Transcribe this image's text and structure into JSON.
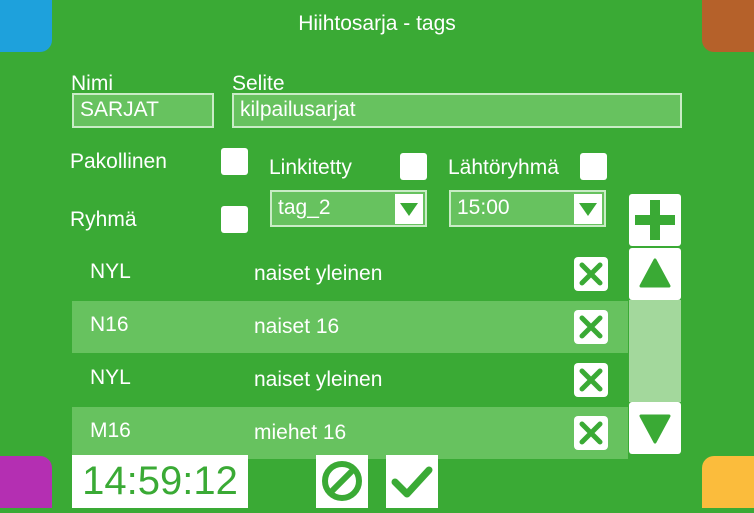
{
  "title": "Hiihtosarja - tags",
  "form": {
    "nimi_label": "Nimi",
    "nimi_value": "SARJAT",
    "selite_label": "Selite",
    "selite_value": "kilpailusarjat",
    "pakollinen_label": "Pakollinen",
    "ryhma_label": "Ryhmä",
    "linkitetty_label": "Linkitetty",
    "lahtoryhma_label": "Lähtöryhmä",
    "linkitetty_select": "tag_2",
    "lahtoryhma_select": "15:00"
  },
  "rows": [
    {
      "code": "NYL",
      "name": "naiset yleinen"
    },
    {
      "code": "N16",
      "name": "naiset 16"
    },
    {
      "code": "NYL",
      "name": "naiset yleinen"
    },
    {
      "code": "M16",
      "name": "miehet 16"
    }
  ],
  "clock": "14:59:12",
  "colors": {
    "background": "#3aaa35",
    "row_alt": "#67c25f",
    "corner_tl": "#1ea1dc",
    "corner_tr": "#b5612a",
    "corner_bl": "#b42fb2",
    "corner_br": "#fbbc3c"
  },
  "icons": {
    "add": "plus-icon",
    "delete": "close-icon",
    "scroll_up": "triangle-up-icon",
    "scroll_down": "triangle-down-icon",
    "cancel": "cancel-icon",
    "confirm": "checkmark-icon"
  }
}
